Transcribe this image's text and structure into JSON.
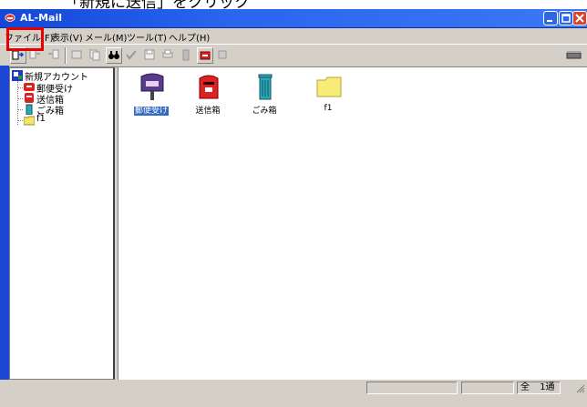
{
  "instruction": "「新規に送信」をクリック",
  "window": {
    "title": "AL-Mail",
    "buttons": {
      "minimize_icon": "minimize-icon",
      "maximize_icon": "maximize-icon",
      "close_icon": "close-icon"
    }
  },
  "menu": [
    "ファイル(F)",
    "表示(V)",
    "メール(M)",
    "ツール(T)",
    "ヘルプ(H)"
  ],
  "toolbar": {
    "buttons": [
      "new-send-icon",
      "reply-icon",
      "forward-icon",
      "mailbox-icon",
      "copy-icon",
      "search-icon",
      "check-icon",
      "save-icon",
      "print-icon",
      "delete-icon",
      "outbox-icon",
      "receive-icon"
    ]
  },
  "tree": {
    "root": "新規アカウント",
    "children": [
      "郵便受け",
      "送信箱",
      "ごみ箱",
      "f1"
    ]
  },
  "list": {
    "items": [
      {
        "label": "郵便受け",
        "icon": "mailbox-icon",
        "selected": true
      },
      {
        "label": "送信箱",
        "icon": "postbox-icon",
        "selected": false
      },
      {
        "label": "ごみ箱",
        "icon": "trash-icon",
        "selected": false
      },
      {
        "label": "f1",
        "icon": "folder-icon",
        "selected": false
      }
    ]
  },
  "status": {
    "total_label": "全",
    "count": "1通"
  },
  "colors": {
    "titlebar": "#2a66ee",
    "highlight": "#e60000",
    "selection": "#316ac5"
  }
}
